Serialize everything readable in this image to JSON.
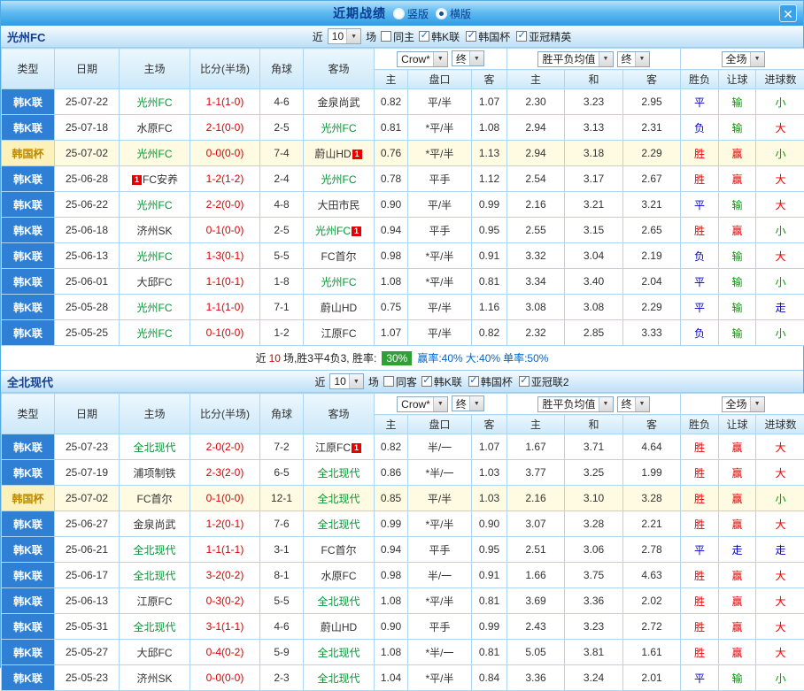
{
  "colors": {
    "accent_blue": "#2f80d5",
    "focal_team_green": "#009933",
    "score_red": "#dd0000",
    "win_red": "#e60000",
    "lose_green": "#009900",
    "draw_blue": "#0000cc",
    "rate_badge_green": "#2fa033",
    "titlebar_blue": "#2e9ce6"
  },
  "titlebar": {
    "title": "近期战绩",
    "layout_options": [
      {
        "label": "竖版",
        "selected": false
      },
      {
        "label": "横版",
        "selected": true
      }
    ],
    "close_label": "✕"
  },
  "table_header": {
    "left_columns": [
      "类型",
      "日期",
      "主场",
      "比分(半场)",
      "角球",
      "客场"
    ],
    "asia_columns": [
      "主",
      "盘口",
      "客"
    ],
    "europe_columns": [
      "主",
      "和",
      "客"
    ],
    "result_columns": [
      "胜负",
      "让球",
      "进球数"
    ]
  },
  "sections": [
    {
      "team": "光州FC",
      "filters": {
        "near_label": "近",
        "count_value": "10",
        "games_label": "场",
        "same_label": "同主",
        "same_checked": false,
        "leagues": [
          {
            "label": "韩K联",
            "checked": true
          },
          {
            "label": "韩国杯",
            "checked": true
          },
          {
            "label": "亚冠精英",
            "checked": true
          }
        ]
      },
      "dropdowns": {
        "company": "Crow*",
        "company_state": "终",
        "europe": "胜平负均值",
        "europe_state": "终",
        "scope": "全场"
      },
      "rows": [
        {
          "league": "韩K联",
          "cup": false,
          "date": "25-07-22",
          "home": {
            "name": "光州FC",
            "focal": true,
            "red": 0
          },
          "score": "1-1(1-0)",
          "corner": "4-6",
          "away": {
            "name": "金泉尚武",
            "focal": false,
            "red": 0
          },
          "asia": [
            "0.82",
            "平/半",
            "1.07"
          ],
          "europe": [
            "2.30",
            "3.23",
            "2.95"
          ],
          "result": [
            "平",
            "输",
            "小"
          ]
        },
        {
          "league": "韩K联",
          "cup": false,
          "date": "25-07-18",
          "home": {
            "name": "水原FC",
            "focal": false,
            "red": 0
          },
          "score": "2-1(0-0)",
          "corner": "2-5",
          "away": {
            "name": "光州FC",
            "focal": true,
            "red": 0
          },
          "asia": [
            "0.81",
            "*平/半",
            "1.08"
          ],
          "europe": [
            "2.94",
            "3.13",
            "2.31"
          ],
          "result": [
            "负",
            "输",
            "大"
          ]
        },
        {
          "league": "韩国杯",
          "cup": true,
          "date": "25-07-02",
          "home": {
            "name": "光州FC",
            "focal": true,
            "red": 0
          },
          "score": "0-0(0-0)",
          "corner": "7-4",
          "away": {
            "name": "蔚山HD",
            "focal": false,
            "red": 1
          },
          "asia": [
            "0.76",
            "*平/半",
            "1.13"
          ],
          "europe": [
            "2.94",
            "3.18",
            "2.29"
          ],
          "result": [
            "胜",
            "赢",
            "小"
          ]
        },
        {
          "league": "韩K联",
          "cup": false,
          "date": "25-06-28",
          "home": {
            "name": "FC安养",
            "focal": false,
            "red": 1
          },
          "score": "1-2(1-2)",
          "corner": "2-4",
          "away": {
            "name": "光州FC",
            "focal": true,
            "red": 0
          },
          "asia": [
            "0.78",
            "平手",
            "1.12"
          ],
          "europe": [
            "2.54",
            "3.17",
            "2.67"
          ],
          "result": [
            "胜",
            "赢",
            "大"
          ]
        },
        {
          "league": "韩K联",
          "cup": false,
          "date": "25-06-22",
          "home": {
            "name": "光州FC",
            "focal": true,
            "red": 0
          },
          "score": "2-2(0-0)",
          "corner": "4-8",
          "away": {
            "name": "大田市民",
            "focal": false,
            "red": 0
          },
          "asia": [
            "0.90",
            "平/半",
            "0.99"
          ],
          "europe": [
            "2.16",
            "3.21",
            "3.21"
          ],
          "result": [
            "平",
            "输",
            "大"
          ]
        },
        {
          "league": "韩K联",
          "cup": false,
          "date": "25-06-18",
          "home": {
            "name": "济州SK",
            "focal": false,
            "red": 0
          },
          "score": "0-1(0-0)",
          "corner": "2-5",
          "away": {
            "name": "光州FC",
            "focal": true,
            "red": 1
          },
          "asia": [
            "0.94",
            "平手",
            "0.95"
          ],
          "europe": [
            "2.55",
            "3.15",
            "2.65"
          ],
          "result": [
            "胜",
            "赢",
            "小"
          ]
        },
        {
          "league": "韩K联",
          "cup": false,
          "date": "25-06-13",
          "home": {
            "name": "光州FC",
            "focal": true,
            "red": 0
          },
          "score": "1-3(0-1)",
          "corner": "5-5",
          "away": {
            "name": "FC首尔",
            "focal": false,
            "red": 0
          },
          "asia": [
            "0.98",
            "*平/半",
            "0.91"
          ],
          "europe": [
            "3.32",
            "3.04",
            "2.19"
          ],
          "result": [
            "负",
            "输",
            "大"
          ]
        },
        {
          "league": "韩K联",
          "cup": false,
          "date": "25-06-01",
          "home": {
            "name": "大邱FC",
            "focal": false,
            "red": 0
          },
          "score": "1-1(0-1)",
          "corner": "1-8",
          "away": {
            "name": "光州FC",
            "focal": true,
            "red": 0
          },
          "asia": [
            "1.08",
            "*平/半",
            "0.81"
          ],
          "europe": [
            "3.34",
            "3.40",
            "2.04"
          ],
          "result": [
            "平",
            "输",
            "小"
          ]
        },
        {
          "league": "韩K联",
          "cup": false,
          "date": "25-05-28",
          "home": {
            "name": "光州FC",
            "focal": true,
            "red": 0
          },
          "score": "1-1(1-0)",
          "corner": "7-1",
          "away": {
            "name": "蔚山HD",
            "focal": false,
            "red": 0
          },
          "asia": [
            "0.75",
            "平/半",
            "1.16"
          ],
          "europe": [
            "3.08",
            "3.08",
            "2.29"
          ],
          "result": [
            "平",
            "输",
            "走"
          ]
        },
        {
          "league": "韩K联",
          "cup": false,
          "date": "25-05-25",
          "home": {
            "name": "光州FC",
            "focal": true,
            "red": 0
          },
          "score": "0-1(0-0)",
          "corner": "1-2",
          "away": {
            "name": "江原FC",
            "focal": false,
            "red": 0
          },
          "asia": [
            "1.07",
            "平/半",
            "0.82"
          ],
          "europe": [
            "2.32",
            "2.85",
            "3.33"
          ],
          "result": [
            "负",
            "输",
            "小"
          ]
        }
      ],
      "summary": {
        "near_label": "近",
        "count": "10",
        "record_text": "场,胜3平4负3, 胜率:",
        "win_rate": "30%",
        "profit_rate": "赢率:40%",
        "big_rate": "大:40%",
        "odd_rate": "单率:50%"
      }
    },
    {
      "team": "全北现代",
      "filters": {
        "near_label": "近",
        "count_value": "10",
        "games_label": "场",
        "same_label": "同客",
        "same_checked": false,
        "leagues": [
          {
            "label": "韩K联",
            "checked": true
          },
          {
            "label": "韩国杯",
            "checked": true
          },
          {
            "label": "亚冠联2",
            "checked": true
          }
        ]
      },
      "dropdowns": {
        "company": "Crow*",
        "company_state": "终",
        "europe": "胜平负均值",
        "europe_state": "终",
        "scope": "全场"
      },
      "rows": [
        {
          "league": "韩K联",
          "cup": false,
          "date": "25-07-23",
          "home": {
            "name": "全北现代",
            "focal": true,
            "red": 0
          },
          "score": "2-0(2-0)",
          "corner": "7-2",
          "away": {
            "name": "江原FC",
            "focal": false,
            "red": 1
          },
          "asia": [
            "0.82",
            "半/一",
            "1.07"
          ],
          "europe": [
            "1.67",
            "3.71",
            "4.64"
          ],
          "result": [
            "胜",
            "赢",
            "大"
          ]
        },
        {
          "league": "韩K联",
          "cup": false,
          "date": "25-07-19",
          "home": {
            "name": "浦项制铁",
            "focal": false,
            "red": 0
          },
          "score": "2-3(2-0)",
          "corner": "6-5",
          "away": {
            "name": "全北现代",
            "focal": true,
            "red": 0
          },
          "asia": [
            "0.86",
            "*半/一",
            "1.03"
          ],
          "europe": [
            "3.77",
            "3.25",
            "1.99"
          ],
          "result": [
            "胜",
            "赢",
            "大"
          ]
        },
        {
          "league": "韩国杯",
          "cup": true,
          "date": "25-07-02",
          "home": {
            "name": "FC首尔",
            "focal": false,
            "red": 0
          },
          "score": "0-1(0-0)",
          "corner": "12-1",
          "away": {
            "name": "全北现代",
            "focal": true,
            "red": 0
          },
          "asia": [
            "0.85",
            "平/半",
            "1.03"
          ],
          "europe": [
            "2.16",
            "3.10",
            "3.28"
          ],
          "result": [
            "胜",
            "赢",
            "小"
          ]
        },
        {
          "league": "韩K联",
          "cup": false,
          "date": "25-06-27",
          "home": {
            "name": "金泉尚武",
            "focal": false,
            "red": 0
          },
          "score": "1-2(0-1)",
          "corner": "7-6",
          "away": {
            "name": "全北现代",
            "focal": true,
            "red": 0
          },
          "asia": [
            "0.99",
            "*平/半",
            "0.90"
          ],
          "europe": [
            "3.07",
            "3.28",
            "2.21"
          ],
          "result": [
            "胜",
            "赢",
            "大"
          ]
        },
        {
          "league": "韩K联",
          "cup": false,
          "date": "25-06-21",
          "home": {
            "name": "全北现代",
            "focal": true,
            "red": 0
          },
          "score": "1-1(1-1)",
          "corner": "3-1",
          "away": {
            "name": "FC首尔",
            "focal": false,
            "red": 0
          },
          "asia": [
            "0.94",
            "平手",
            "0.95"
          ],
          "europe": [
            "2.51",
            "3.06",
            "2.78"
          ],
          "result": [
            "平",
            "走",
            "走"
          ]
        },
        {
          "league": "韩K联",
          "cup": false,
          "date": "25-06-17",
          "home": {
            "name": "全北现代",
            "focal": true,
            "red": 0
          },
          "score": "3-2(0-2)",
          "corner": "8-1",
          "away": {
            "name": "水原FC",
            "focal": false,
            "red": 0
          },
          "asia": [
            "0.98",
            "半/一",
            "0.91"
          ],
          "europe": [
            "1.66",
            "3.75",
            "4.63"
          ],
          "result": [
            "胜",
            "赢",
            "大"
          ]
        },
        {
          "league": "韩K联",
          "cup": false,
          "date": "25-06-13",
          "home": {
            "name": "江原FC",
            "focal": false,
            "red": 0
          },
          "score": "0-3(0-2)",
          "corner": "5-5",
          "away": {
            "name": "全北现代",
            "focal": true,
            "red": 0
          },
          "asia": [
            "1.08",
            "*平/半",
            "0.81"
          ],
          "europe": [
            "3.69",
            "3.36",
            "2.02"
          ],
          "result": [
            "胜",
            "赢",
            "大"
          ]
        },
        {
          "league": "韩K联",
          "cup": false,
          "date": "25-05-31",
          "home": {
            "name": "全北现代",
            "focal": true,
            "red": 0
          },
          "score": "3-1(1-1)",
          "corner": "4-6",
          "away": {
            "name": "蔚山HD",
            "focal": false,
            "red": 0
          },
          "asia": [
            "0.90",
            "平手",
            "0.99"
          ],
          "europe": [
            "2.43",
            "3.23",
            "2.72"
          ],
          "result": [
            "胜",
            "赢",
            "大"
          ]
        },
        {
          "league": "韩K联",
          "cup": false,
          "date": "25-05-27",
          "home": {
            "name": "大邱FC",
            "focal": false,
            "red": 0
          },
          "score": "0-4(0-2)",
          "corner": "5-9",
          "away": {
            "name": "全北现代",
            "focal": true,
            "red": 0
          },
          "asia": [
            "1.08",
            "*半/一",
            "0.81"
          ],
          "europe": [
            "5.05",
            "3.81",
            "1.61"
          ],
          "result": [
            "胜",
            "赢",
            "大"
          ]
        },
        {
          "league": "韩K联",
          "cup": false,
          "date": "25-05-23",
          "home": {
            "name": "济州SK",
            "focal": false,
            "red": 0
          },
          "score": "0-0(0-0)",
          "corner": "2-3",
          "away": {
            "name": "全北现代",
            "focal": true,
            "red": 0
          },
          "asia": [
            "1.04",
            "*平/半",
            "0.84"
          ],
          "europe": [
            "3.36",
            "3.24",
            "2.01"
          ],
          "result": [
            "平",
            "输",
            "小"
          ]
        }
      ]
    }
  ]
}
